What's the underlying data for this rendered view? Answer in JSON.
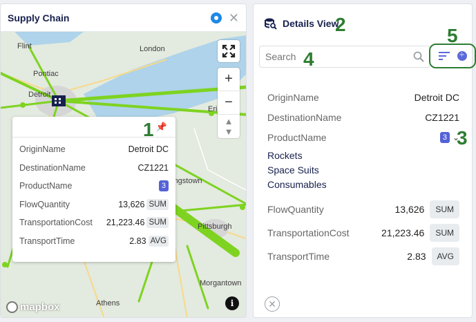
{
  "map_panel": {
    "title": "Supply Chain",
    "cities": [
      "Flint",
      "London",
      "Pontiac",
      "Detroit",
      "Erie",
      "Youngstown",
      "Pittsburgh",
      "Morgantown",
      "Athens"
    ],
    "attribution": "mapbox",
    "popup": {
      "rows": [
        {
          "label": "OriginName",
          "value": "Detroit DC"
        },
        {
          "label": "DestinationName",
          "value": "CZ1221"
        },
        {
          "label": "ProductName",
          "badge": "3"
        },
        {
          "label": "FlowQuantity",
          "value": "13,626",
          "agg": "SUM"
        },
        {
          "label": "TransportationCost",
          "value": "21,223.46",
          "agg": "SUM"
        },
        {
          "label": "TransportTime",
          "value": "2.83",
          "agg": "AVG"
        }
      ]
    }
  },
  "details": {
    "title": "Details View",
    "search": {
      "placeholder": "Search",
      "value": ""
    },
    "rows": {
      "origin": {
        "label": "OriginName",
        "value": "Detroit DC"
      },
      "destination": {
        "label": "DestinationName",
        "value": "CZ1221"
      },
      "product": {
        "label": "ProductName",
        "badge": "3",
        "items": [
          "Rockets",
          "Space Suits",
          "Consumables"
        ]
      },
      "flow": {
        "label": "FlowQuantity",
        "value": "13,626",
        "agg": "SUM"
      },
      "cost": {
        "label": "TransportationCost",
        "value": "21,223.46",
        "agg": "SUM"
      },
      "time": {
        "label": "TransportTime",
        "value": "2.83",
        "agg": "AVG"
      }
    }
  },
  "annotations": [
    "1",
    "2",
    "3",
    "4",
    "5"
  ],
  "colors": {
    "accent": "#5b6ad9",
    "flow_lines": "#7ed321",
    "annotation": "#2e7d32",
    "water": "#aed3ea"
  }
}
